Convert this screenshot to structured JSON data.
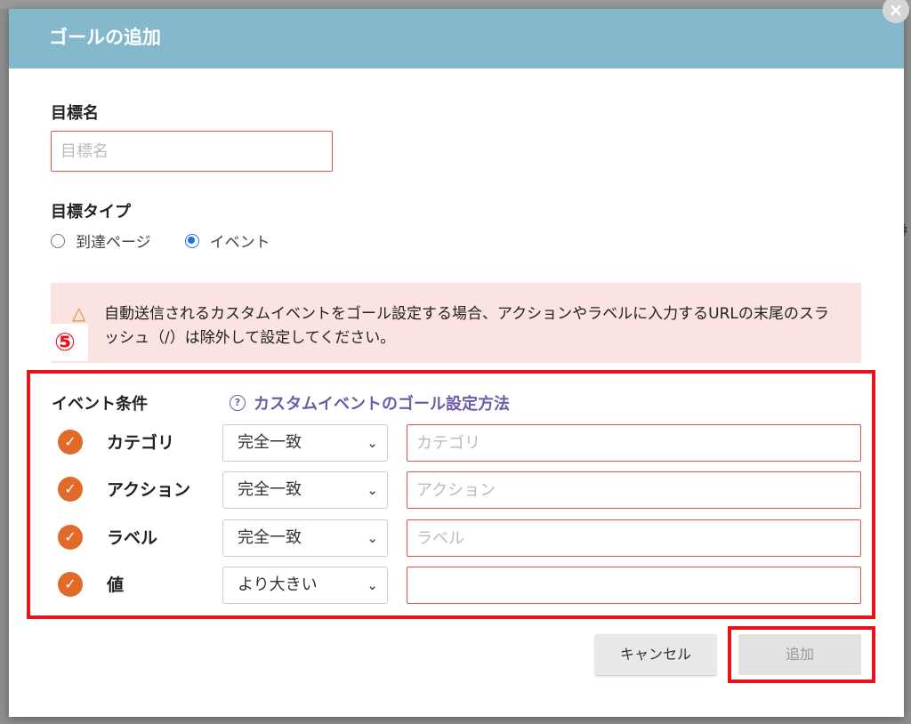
{
  "dialog": {
    "title": "ゴールの追加",
    "close_glyph": "×"
  },
  "goal_name": {
    "label": "目標名",
    "placeholder": "目標名",
    "value": ""
  },
  "goal_type": {
    "label": "目標タイプ",
    "options": [
      {
        "label": "到達ページ",
        "selected": false
      },
      {
        "label": "イベント",
        "selected": true
      }
    ]
  },
  "warning": {
    "icon": "warning-triangle-icon",
    "text": "自動送信されるカスタムイベントをゴール設定する場合、アクションやラベルに入力するURLの末尾のスラッシュ（/）は除外して設定してください。"
  },
  "step_marker": "⑤",
  "conditions": {
    "title": "イベント条件",
    "help_link": "カスタムイベントのゴール設定方法",
    "rows": [
      {
        "label": "カテゴリ",
        "match": "完全一致",
        "placeholder": "カテゴリ",
        "value": ""
      },
      {
        "label": "アクション",
        "match": "完全一致",
        "placeholder": "アクション",
        "value": ""
      },
      {
        "label": "ラベル",
        "match": "完全一致",
        "placeholder": "ラベル",
        "value": ""
      },
      {
        "label": "値",
        "match": "より大きい",
        "placeholder": "",
        "value": ""
      }
    ]
  },
  "footer": {
    "cancel_label": "キャンセル",
    "add_label": "追加"
  },
  "colors": {
    "header": "#84b8cc",
    "highlight": "#e8141c",
    "check": "#e06a2a",
    "link": "#6e5ba8",
    "warning_bg": "#fbe3e2"
  }
}
